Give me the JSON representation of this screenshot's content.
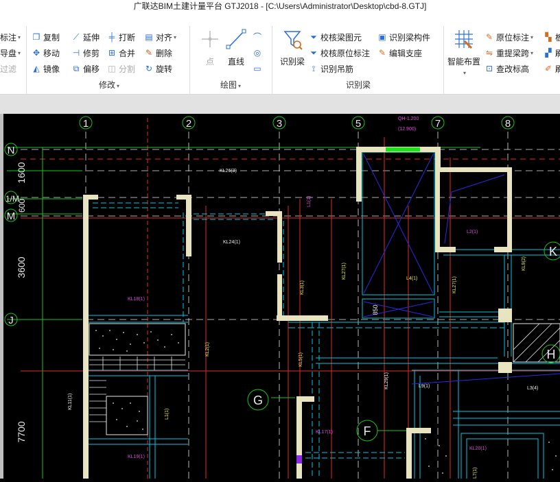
{
  "window": {
    "title": "广联达BIM土建计量平台 GTJ2018 - [C:\\Users\\Administrator\\Desktop\\cbd-8.GTJ]"
  },
  "ribbon": {
    "partial_left": [
      "标注",
      "导盘",
      "过滤"
    ],
    "modify": {
      "label": "修改",
      "items": {
        "copy": "复制",
        "extend": "延伸",
        "break": "打断",
        "align": "对齐",
        "move": "移动",
        "trim": "修剪",
        "merge": "合并",
        "delete": "删除",
        "mirror": "镜像",
        "offset": "偏移",
        "split": "分割",
        "rotate": "旋转"
      }
    },
    "draw": {
      "label": "绘图",
      "point": "点",
      "line": "直线"
    },
    "recognize_beam": {
      "label": "识别梁",
      "big_button": "识别梁",
      "check_elements": "校核梁图元",
      "check_annotation": "校核原位标注",
      "recognize_hanger": "识别吊筋",
      "recognize_component": "识别梁构件",
      "edit_support": "编辑支座"
    },
    "smart": {
      "big_button": "智能布置",
      "in_situ": "原位标注",
      "reextract": "重提梁跨",
      "check_elev": "查改标高"
    },
    "partial_right": [
      "板",
      "刷",
      "刷"
    ]
  },
  "drawing": {
    "axis_top": [
      "1",
      "2",
      "3",
      "5",
      "7",
      "8"
    ],
    "axis_left": [
      "N",
      "1/M",
      "M",
      "J"
    ],
    "axis_circles": [
      "K",
      "G",
      "F",
      "H"
    ],
    "dims_left": [
      "1600",
      "600",
      "3600",
      "7700"
    ],
    "top_note_1": "QH-1.200",
    "top_note_2": "(12.900)",
    "dim_850": "850",
    "beams": {
      "kl26": "KL26(3)",
      "kl24": "KL24(1)",
      "l1": "L1(1)",
      "kl18": "KL18(1)",
      "kl27": "KL27(1)",
      "l4": "L4(1)",
      "kl3": "KL3(1)",
      "kl27b": "KL27(1)",
      "l2": "L2(1)",
      "kl9": "KL9(2)",
      "kl2": "KL2(1)",
      "kl5": "KL5(1)",
      "kl29": "KL29(1)",
      "l9": "L9(1)",
      "l3": "L3(4)",
      "kl11": "KL11(1)",
      "l11": "L1(1)",
      "kl17": "KL17(1)",
      "kl19": "KL19(1)",
      "kl20": "KL20(1)",
      "l7": "L7(1)"
    }
  },
  "colors": {
    "red_axis": "#e22a2a",
    "wall": "#e8e4c0",
    "cyan": "#00c8e6",
    "green": "#19c819",
    "blue": "#2a2ae6",
    "magenta": "#e24ae2",
    "yellow": "#e8e840"
  }
}
